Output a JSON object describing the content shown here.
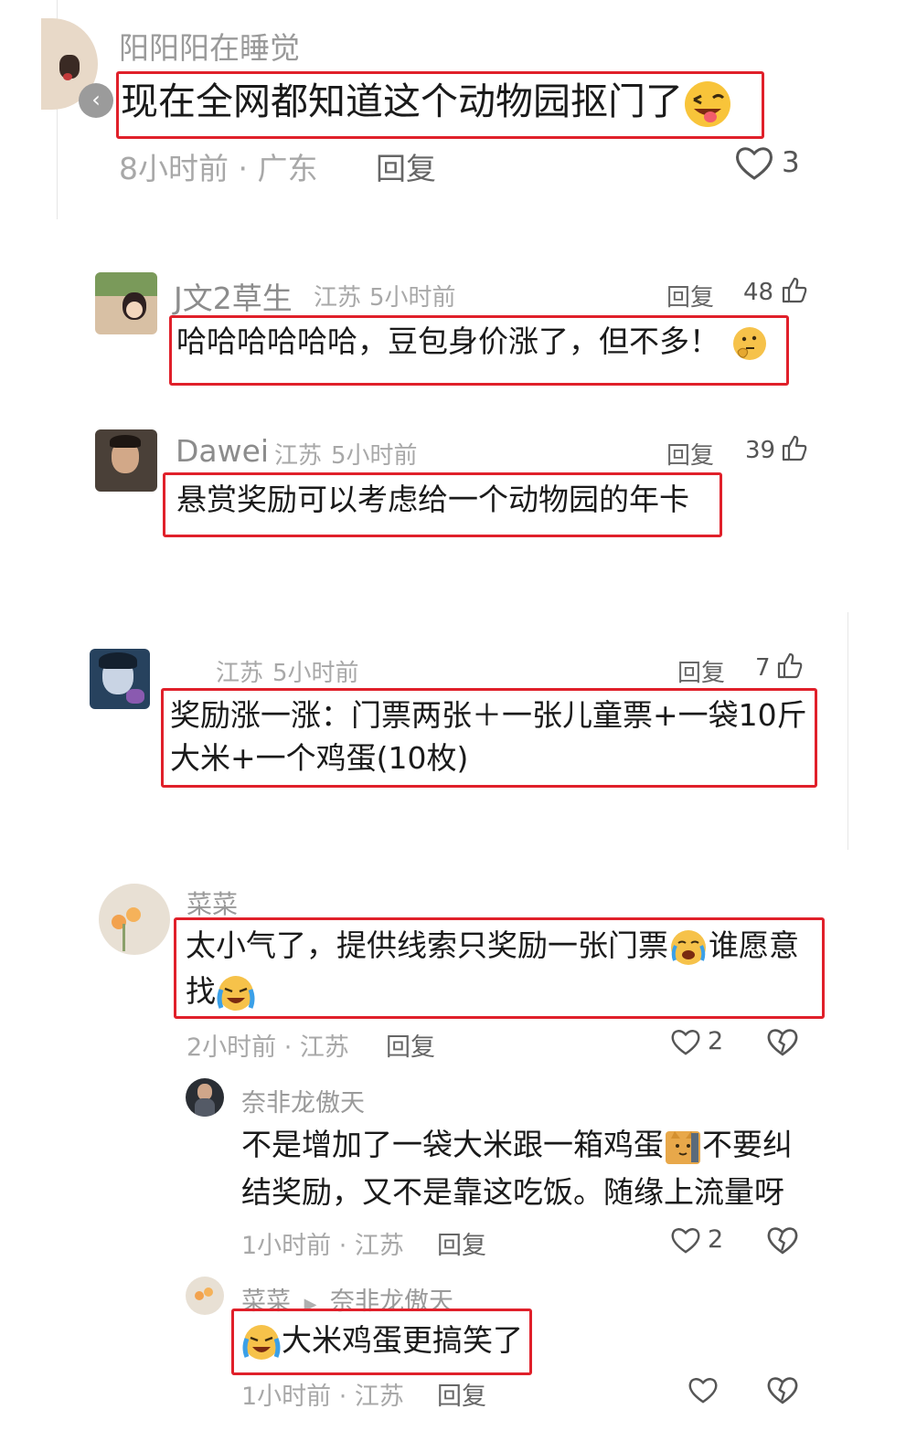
{
  "comments": [
    {
      "name": "阳阳阳在睡觉",
      "text": "现在全网都知道这个动物园抠门了",
      "time": "8小时前 · 广东",
      "reply": "回复",
      "likes": "3"
    },
    {
      "name": "J文2草生",
      "location": "江苏",
      "time": "5小时前",
      "text": "哈哈哈哈哈哈，豆包身价涨了，但不多！",
      "reply": "回复",
      "likes": "48"
    },
    {
      "name": "Dawei",
      "location": "江苏",
      "time": "5小时前",
      "text": "悬赏奖励可以考虑给一个动物园的年卡",
      "reply": "回复",
      "likes": "39"
    },
    {
      "location": "江苏",
      "time": "5小时前",
      "text_line1": "奖励涨一涨：门票两张＋一张儿童票+一袋10斤",
      "text_line2": "大米+一个鸡蛋(10枚)",
      "reply": "回复",
      "likes": "7"
    },
    {
      "name": "菜菜",
      "text_line1a": "太小气了，提供线索只奖励一张门票",
      "text_line1b": "谁愿意",
      "text_line2": "找",
      "time": "2小时前 · 江苏",
      "reply": "回复",
      "likes": "2"
    }
  ],
  "replies": [
    {
      "name": "奈非龙傲天",
      "text_line1a": "不是增加了一袋大米跟一箱鸡蛋",
      "text_line1b": "不要纠",
      "text_line2": "结奖励，又不是靠这吃饭。随缘上流量呀",
      "time": "1小时前 · 江苏",
      "reply": "回复",
      "likes": "2"
    },
    {
      "name": "菜菜",
      "arrow": "▶",
      "to": "奈非龙傲天",
      "text": "大米鸡蛋更搞笑了",
      "time": "1小时前 · 江苏",
      "reply": "回复"
    }
  ],
  "colors": {
    "highlight": "#e0202a",
    "meta": "#a8a8a8",
    "text": "#1a1a1a"
  }
}
